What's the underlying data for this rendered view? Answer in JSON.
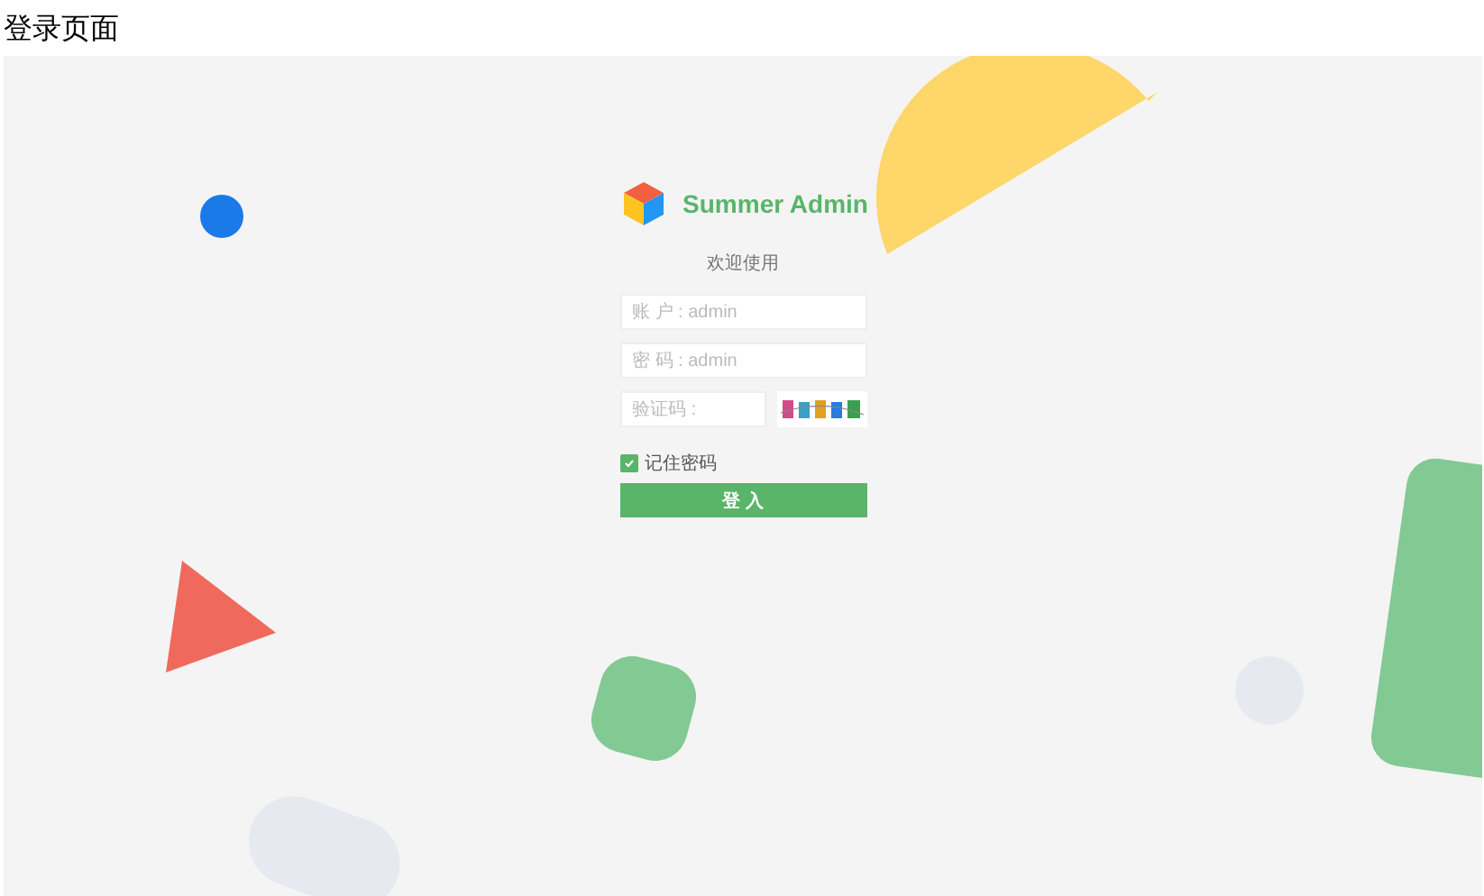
{
  "page_title": "登录页面",
  "login": {
    "brand": "Summer Admin",
    "welcome": "欢迎使用",
    "fields": [
      {
        "kind": "text",
        "placeholder": "账 户 : admin"
      },
      {
        "kind": "password",
        "placeholder": "密 码 : admin"
      },
      {
        "kind": "captcha",
        "placeholder": "验证码 :"
      }
    ],
    "remember": {
      "label": "记住密码",
      "checked": true
    },
    "submit": "登 入"
  }
}
